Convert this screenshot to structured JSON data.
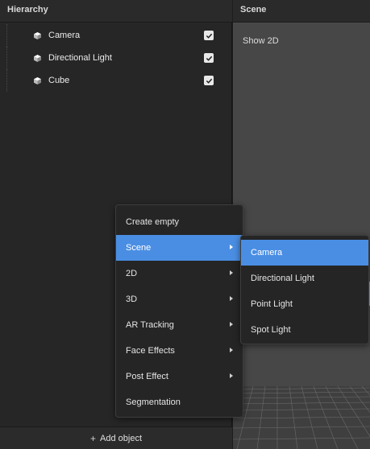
{
  "hierarchy": {
    "title": "Hierarchy",
    "items": [
      {
        "label": "Camera",
        "visible": true
      },
      {
        "label": "Directional Light",
        "visible": true
      },
      {
        "label": "Cube",
        "visible": true
      }
    ],
    "add_object_label": "Add object"
  },
  "scene": {
    "title": "Scene",
    "show2d_label": "Show 2D"
  },
  "context_menu": {
    "items": [
      {
        "label": "Create empty",
        "submenu": false
      },
      {
        "label": "Scene",
        "submenu": true,
        "active": true
      },
      {
        "label": "2D",
        "submenu": true
      },
      {
        "label": "3D",
        "submenu": true
      },
      {
        "label": "AR Tracking",
        "submenu": true
      },
      {
        "label": "Face Effects",
        "submenu": true
      },
      {
        "label": "Post Effect",
        "submenu": true
      },
      {
        "label": "Segmentation",
        "submenu": false
      }
    ],
    "submenu_items": [
      {
        "label": "Camera",
        "active": true
      },
      {
        "label": "Directional Light"
      },
      {
        "label": "Point Light"
      },
      {
        "label": "Spot Light"
      }
    ]
  },
  "colors": {
    "accent": "#4a8ee3",
    "panel_bg": "#262626",
    "viewport_bg": "#474747"
  }
}
